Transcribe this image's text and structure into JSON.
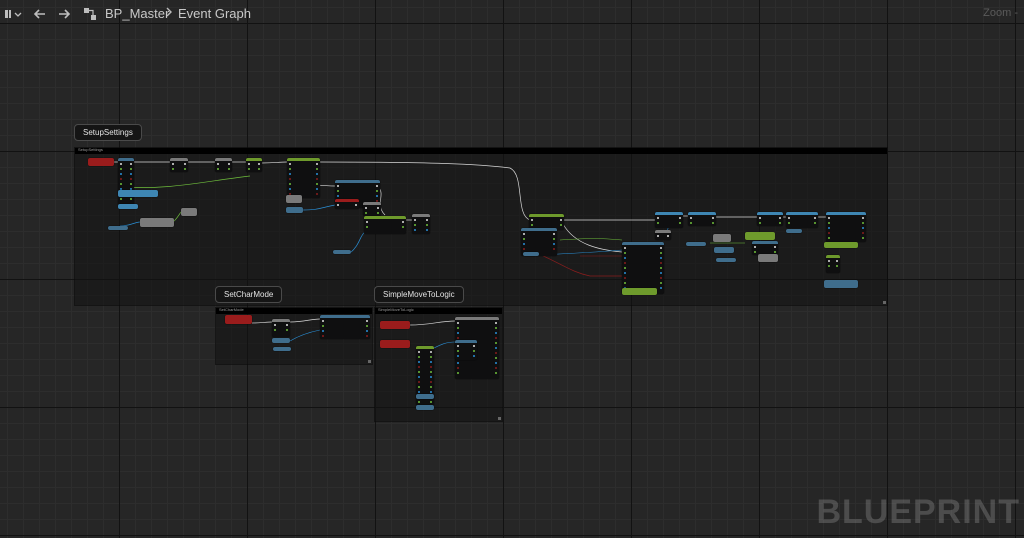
{
  "toolbar": {
    "blueprint_menu_icon": "blueprint-menu-icon",
    "back_icon": "arrow-left",
    "forward_icon": "arrow-right"
  },
  "breadcrumb": {
    "asset": "BP_Master",
    "separator": ">",
    "graph": "Event Graph"
  },
  "zoom_label": "Zoom -",
  "watermark": "BLUEPRINT",
  "comments": [
    {
      "title": "SetupSettings",
      "header": "SetupSettings"
    },
    {
      "title": "SetCharMode",
      "header": "SetCharMode"
    },
    {
      "title": "SimpleMoveToLogic",
      "header": "SimpleMoveToLogic"
    }
  ],
  "colors": {
    "event": "#9a1c1c",
    "function": "#3f6d8c",
    "variable_green": "#6e9a2c",
    "macro": "#7a7a7a",
    "struct": "#3e86b3",
    "flow_wire": "#d9d9d9",
    "bool_wire": "#8a1d1d",
    "float_wire": "#6fbf3c",
    "object_wire": "#2a8fd6"
  }
}
